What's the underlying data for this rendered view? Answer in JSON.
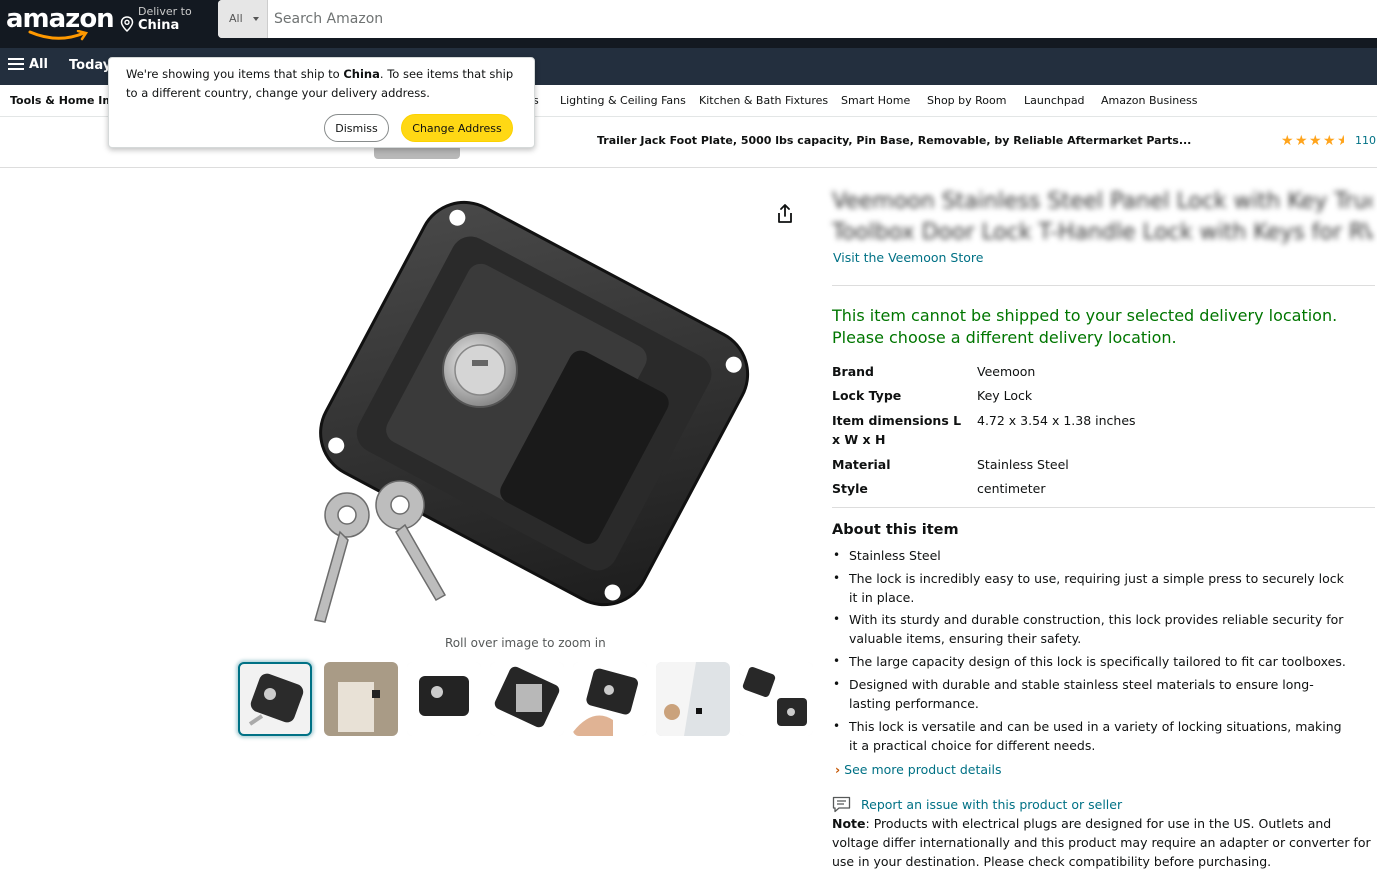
{
  "header": {
    "logo_text": "amazon",
    "deliver_to_label": "Deliver to",
    "deliver_to_location": "China",
    "search": {
      "category": "All",
      "placeholder": "Search Amazon"
    }
  },
  "nav": {
    "all_label": "All",
    "today_label": "Today's"
  },
  "subnav": [
    "Tools & Home Improvement",
    "s",
    "Lighting & Ceiling Fans",
    "Kitchen & Bath Fixtures",
    "Smart Home",
    "Shop by Room",
    "Launchpad",
    "Amazon Business"
  ],
  "sticky": {
    "product_title": "Trailer Jack Foot Plate, 5000 lbs capacity, Pin Base, Removable, by Reliable Aftermarket Parts...",
    "rating": 4.5,
    "rating_count": "110"
  },
  "popover": {
    "msg_before": "We're showing you items that ship to ",
    "msg_country": "China",
    "msg_after": ". To see items that ship to a different country, change your delivery address.",
    "dismiss_label": "Dismiss",
    "change_label": "Change Address"
  },
  "gallery": {
    "zoom_hint": "Roll over image to zoom in",
    "thumbnail_count": 7,
    "selected_index": 0
  },
  "product": {
    "title_line1": "Veemoon Stainless Steel Panel Lock with Key Truck",
    "title_line2": "Toolbox Door Lock T-Handle Lock with Keys for RV",
    "store_link": "Visit the Veemoon Store",
    "shipping_warning": "This item cannot be shipped to your selected delivery location. Please choose a different delivery location.",
    "specs": [
      {
        "key": "Brand",
        "value": "Veemoon"
      },
      {
        "key": "Lock Type",
        "value": "Key Lock"
      },
      {
        "key": "Item dimensions L x W x H",
        "value": "4.72 x 3.54 x 1.38 inches"
      },
      {
        "key": "Material",
        "value": "Stainless Steel"
      },
      {
        "key": "Style",
        "value": "centimeter"
      }
    ],
    "about_heading": "About this item",
    "bullets": [
      "Stainless Steel",
      "The lock is incredibly easy to use, requiring just a simple press to securely lock it in place.",
      "With its sturdy and durable construction, this lock provides reliable security for valuable items, ensuring their safety.",
      "The large capacity design of this lock is specifically tailored to fit car toolboxes.",
      "Designed with durable and stable stainless steel materials to ensure long-lasting performance.",
      "This lock is versatile and can be used in a variety of locking situations, making it a practical choice for different needs."
    ],
    "see_more": "See more product details",
    "report_link": "Report an issue with this product or seller",
    "note_label": "Note",
    "note_text": ": Products with electrical plugs are designed for use in the US. Outlets and voltage differ internationally and this product may require an adapter or converter for use in your destination. Please check compatibility before purchasing."
  },
  "colors": {
    "nav_dark": "#131921",
    "nav_secondary": "#232f3e",
    "link": "#007185",
    "warning_green": "#007600",
    "button_yellow": "#ffd814",
    "star": "#ffa41c"
  }
}
